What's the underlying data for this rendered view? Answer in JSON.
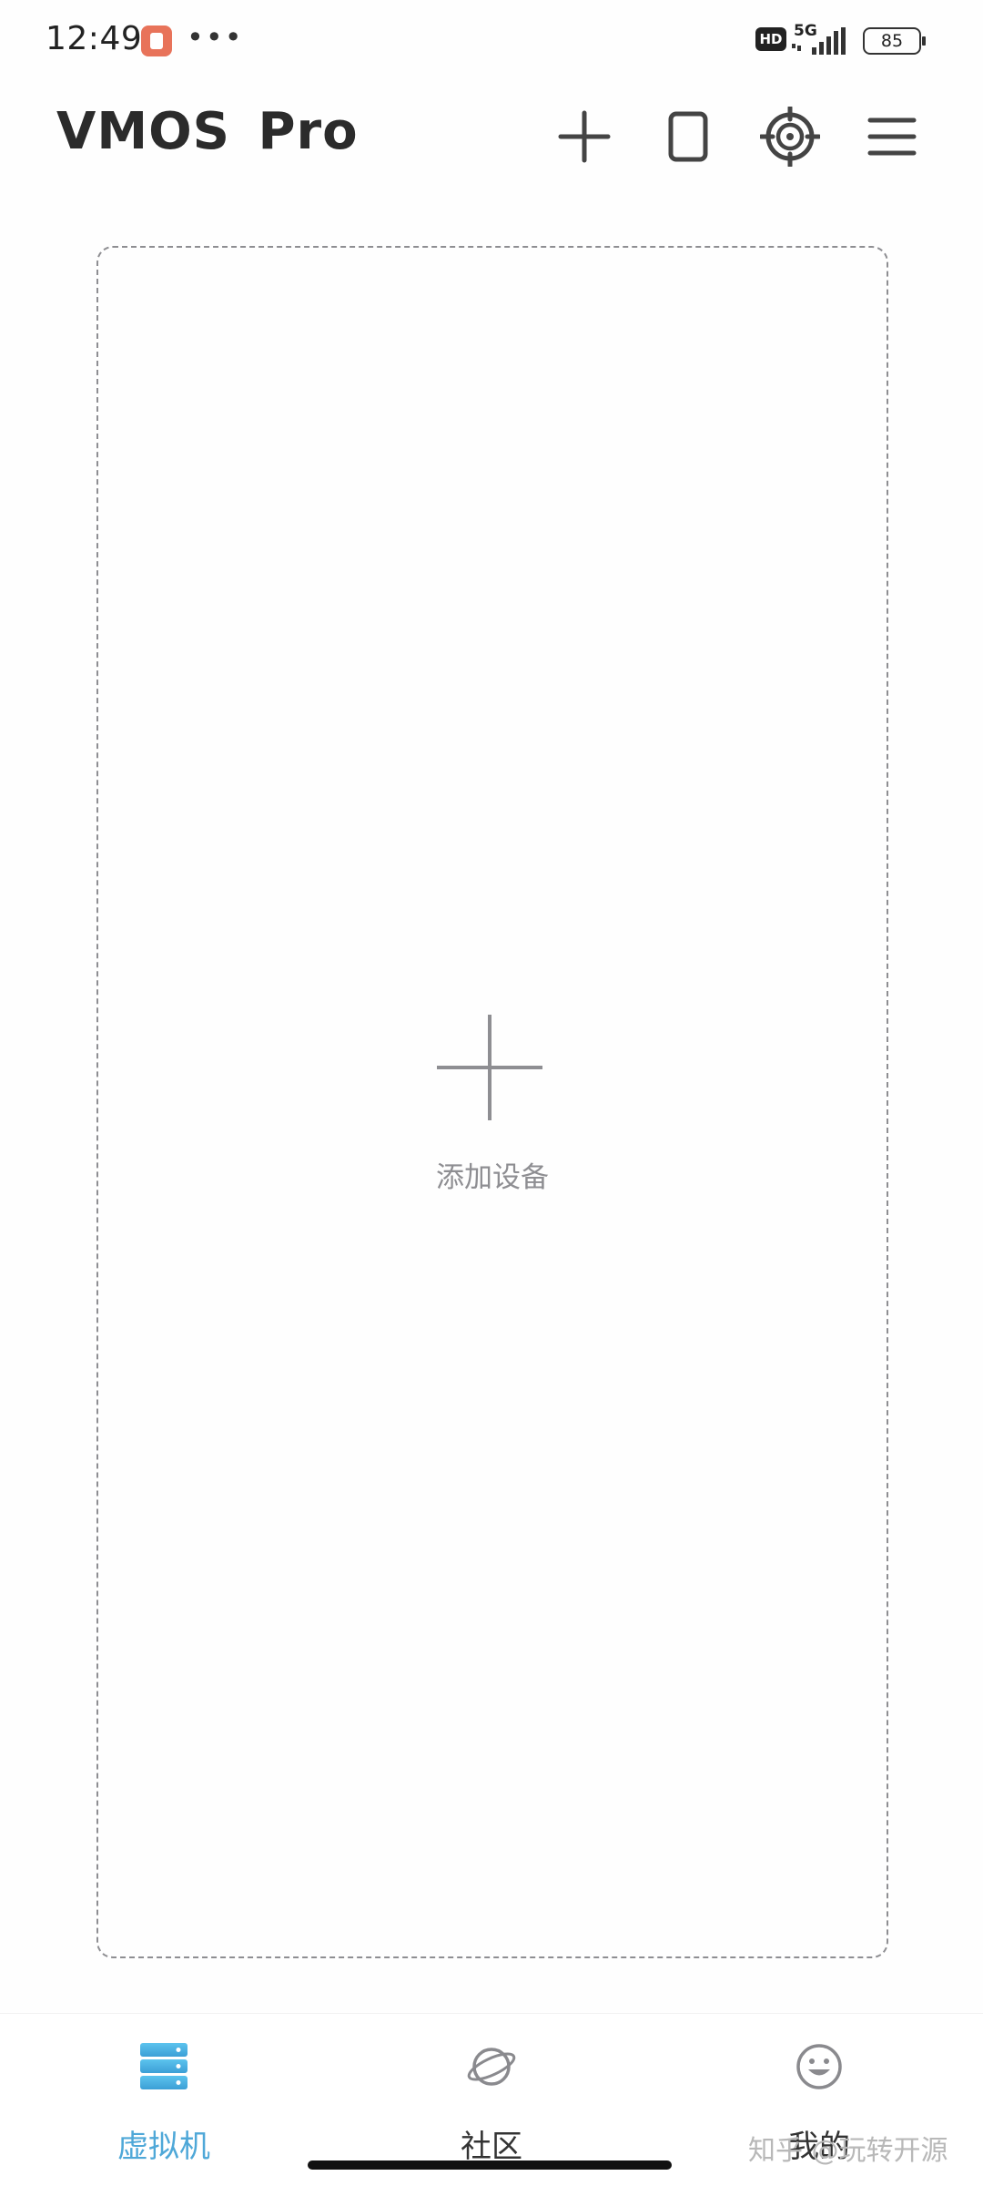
{
  "status_bar": {
    "time": "12:49",
    "notification_icon": "app-notification-icon",
    "more_dots": "•••",
    "hd_badge": "HD",
    "network": "5G",
    "battery_level": "85"
  },
  "header": {
    "title": "VMOS  Pro",
    "actions": [
      {
        "name": "add-icon"
      },
      {
        "name": "window-icon"
      },
      {
        "name": "crosshair-icon"
      },
      {
        "name": "menu-icon"
      }
    ]
  },
  "main": {
    "add_device_label": "添加设备"
  },
  "bottom_nav": {
    "items": [
      {
        "label": "虚拟机",
        "icon": "server-icon",
        "active": true
      },
      {
        "label": "社区",
        "icon": "planet-icon",
        "active": false
      },
      {
        "label": "我的",
        "icon": "smiley-icon",
        "active": false
      }
    ]
  },
  "watermark": "知乎 @玩转开源",
  "colors": {
    "accent": "#4fa8d8",
    "text_dark": "#2b2b2b",
    "muted": "#8e8e92"
  }
}
